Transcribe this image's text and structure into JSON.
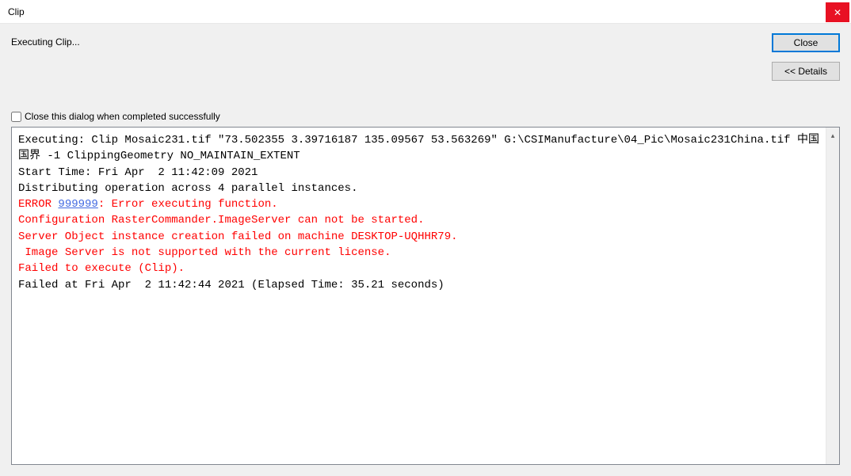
{
  "titlebar": {
    "title": "Clip",
    "closeGlyph": "✕"
  },
  "status": {
    "label": "Executing Clip..."
  },
  "buttons": {
    "close": "Close",
    "details": "<< Details"
  },
  "checkbox": {
    "label": "Close this dialog when completed successfully",
    "checked": false
  },
  "log": {
    "line1": "Executing: Clip Mosaic231.tif \"73.502355 3.39716187 135.09567 53.563269\" G:\\CSIManufacture\\04_Pic\\Mosaic231China.tif 中国国界 -1 ClippingGeometry NO_MAINTAIN_EXTENT",
    "line2": "Start Time: Fri Apr  2 11:42:09 2021",
    "line3": "Distributing operation across 4 parallel instances.",
    "line4_prefix": "ERROR ",
    "line4_code": "999999",
    "line4_suffix": ": Error executing function.",
    "line5": "Configuration RasterCommander.ImageServer can not be started.",
    "line6": "",
    "line7": "Server Object instance creation failed on machine DESKTOP-UQHHR79.",
    "line8": "",
    "line9": " Image Server is not supported with the current license.",
    "line10": "",
    "line11": "Failed to execute (Clip).",
    "line12": "Failed at Fri Apr  2 11:42:44 2021 (Elapsed Time: 35.21 seconds)"
  },
  "scrollbar": {
    "arrowUp": "▴"
  }
}
